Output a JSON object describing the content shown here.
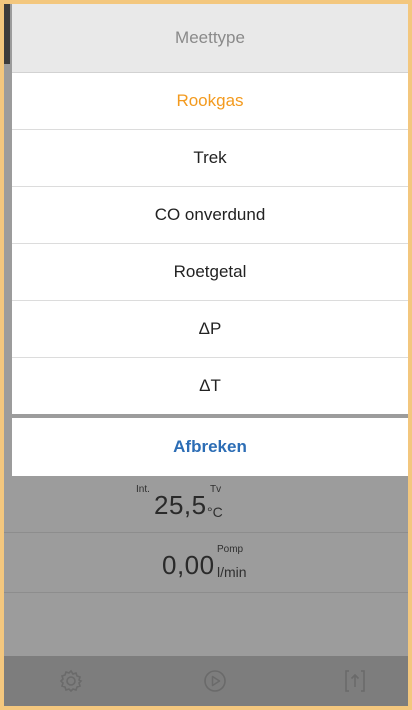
{
  "sheet": {
    "title": "Meettype",
    "options": [
      {
        "label": "Rookgas",
        "selected": true
      },
      {
        "label": "Trek",
        "selected": false
      },
      {
        "label": "CO onverdund",
        "selected": false
      },
      {
        "label": "Roetgetal",
        "selected": false
      },
      {
        "label": "ΔP",
        "selected": false
      },
      {
        "label": "ΔT",
        "selected": false
      }
    ],
    "cancel_label": "Afbreken"
  },
  "readings": [
    {
      "prefix": "Int.",
      "value": "25,5",
      "label": "Tv",
      "unit": "°C"
    },
    {
      "prefix": "",
      "value": "0,00",
      "label": "Pomp",
      "unit": "l/min"
    }
  ],
  "bottom_bar": {
    "icons": [
      "settings-gear-icon",
      "play-circle-icon",
      "export-upload-icon"
    ]
  },
  "colors": {
    "accent_selected": "#f39a1e",
    "cancel_text": "#2c6db5",
    "outer_border": "#f3c77e"
  }
}
